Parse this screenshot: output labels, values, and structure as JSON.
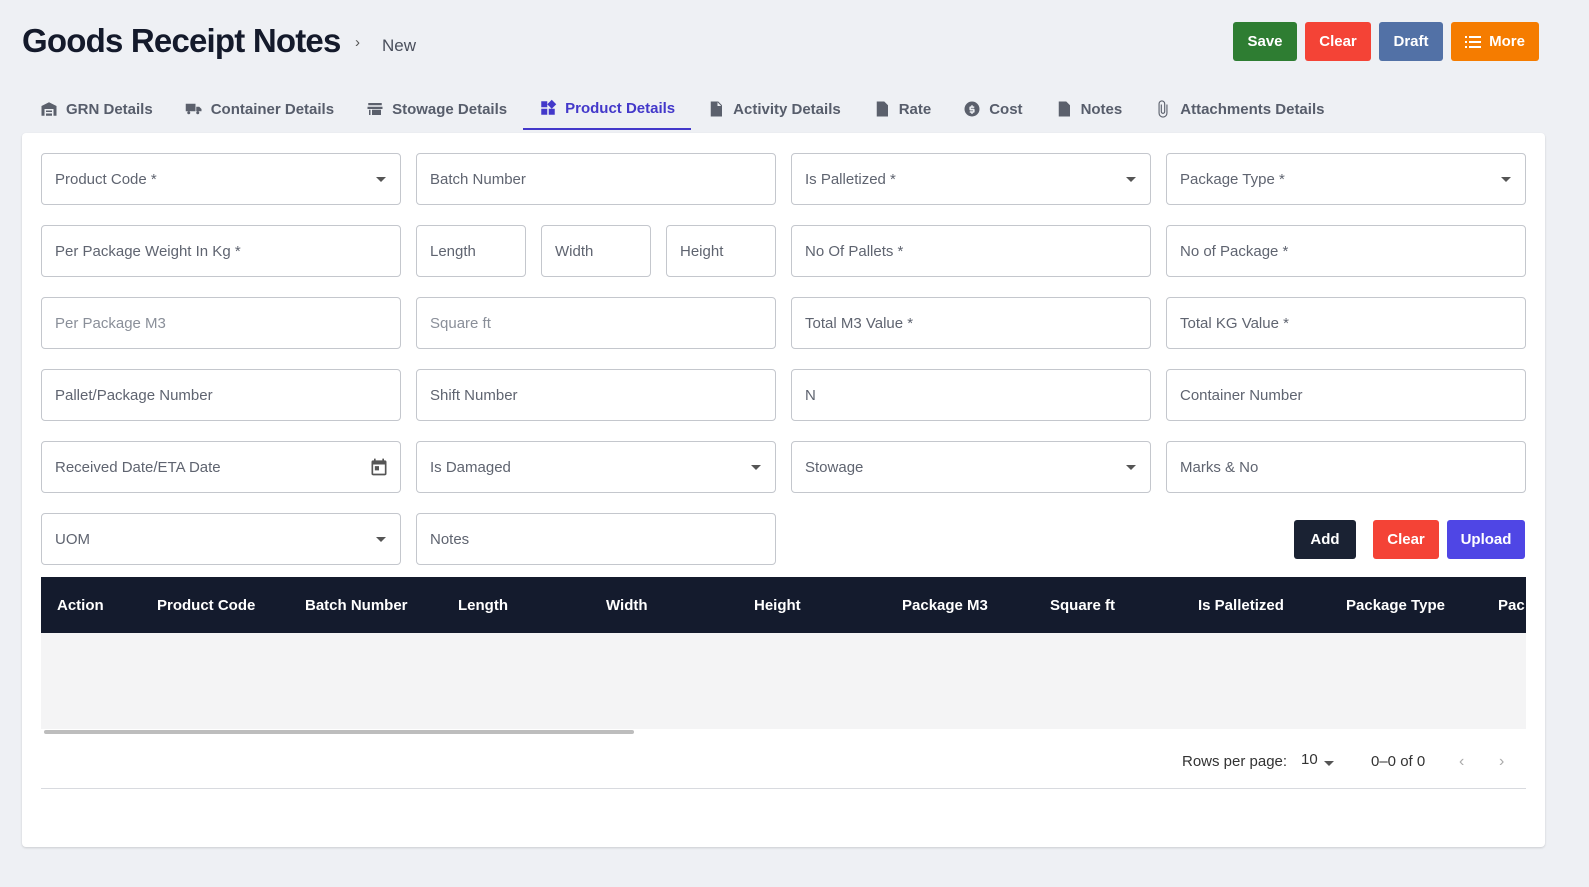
{
  "header": {
    "title": "Goods Receipt Notes",
    "separator": "›",
    "crumb": "New"
  },
  "actions": {
    "save": "Save",
    "clear": "Clear",
    "draft": "Draft",
    "more": "More"
  },
  "tabs": [
    {
      "label": "GRN Details",
      "icon": "warehouse-icon"
    },
    {
      "label": "Container Details",
      "icon": "truck-icon"
    },
    {
      "label": "Stowage Details",
      "icon": "store-icon"
    },
    {
      "label": "Product Details",
      "icon": "widgets-icon",
      "active": true
    },
    {
      "label": "Activity Details",
      "icon": "file-icon"
    },
    {
      "label": "Rate",
      "icon": "dollar-file-icon"
    },
    {
      "label": "Cost",
      "icon": "dollar-circle-icon"
    },
    {
      "label": "Notes",
      "icon": "document-icon"
    },
    {
      "label": "Attachments Details",
      "icon": "paperclip-icon"
    }
  ],
  "form": {
    "product_code": "Product Code *",
    "batch_number": "Batch Number",
    "is_palletized": "Is Palletized *",
    "package_type": "Package Type *",
    "per_package_weight": "Per Package Weight In Kg *",
    "length": "Length",
    "width": "Width",
    "height": "Height",
    "no_of_pallets": "No Of Pallets *",
    "no_of_package": "No of Package *",
    "per_package_m3": "Per Package M3",
    "square_ft": "Square ft",
    "total_m3": "Total M3 Value *",
    "total_kg": "Total KG Value *",
    "pallet_package_number": "Pallet/Package Number",
    "shift_number": "Shift Number",
    "n_value": "N",
    "container_number": "Container Number",
    "received_date": "Received Date/ETA Date",
    "is_damaged": "Is Damaged",
    "stowage": "Stowage",
    "marks_no": "Marks & No",
    "uom": "UOM",
    "notes": "Notes"
  },
  "form_actions": {
    "add": "Add",
    "clear": "Clear",
    "upload": "Upload"
  },
  "grid": {
    "columns": [
      "Action",
      "Product Code",
      "Batch Number",
      "Length",
      "Width",
      "Height",
      "Package M3",
      "Square ft",
      "Is Palletized",
      "Package Type",
      "Pac"
    ],
    "rows_per_page_label": "Rows per page:",
    "rows_per_page": "10",
    "range": "0–0 of 0",
    "prev": "‹",
    "next": "›"
  }
}
